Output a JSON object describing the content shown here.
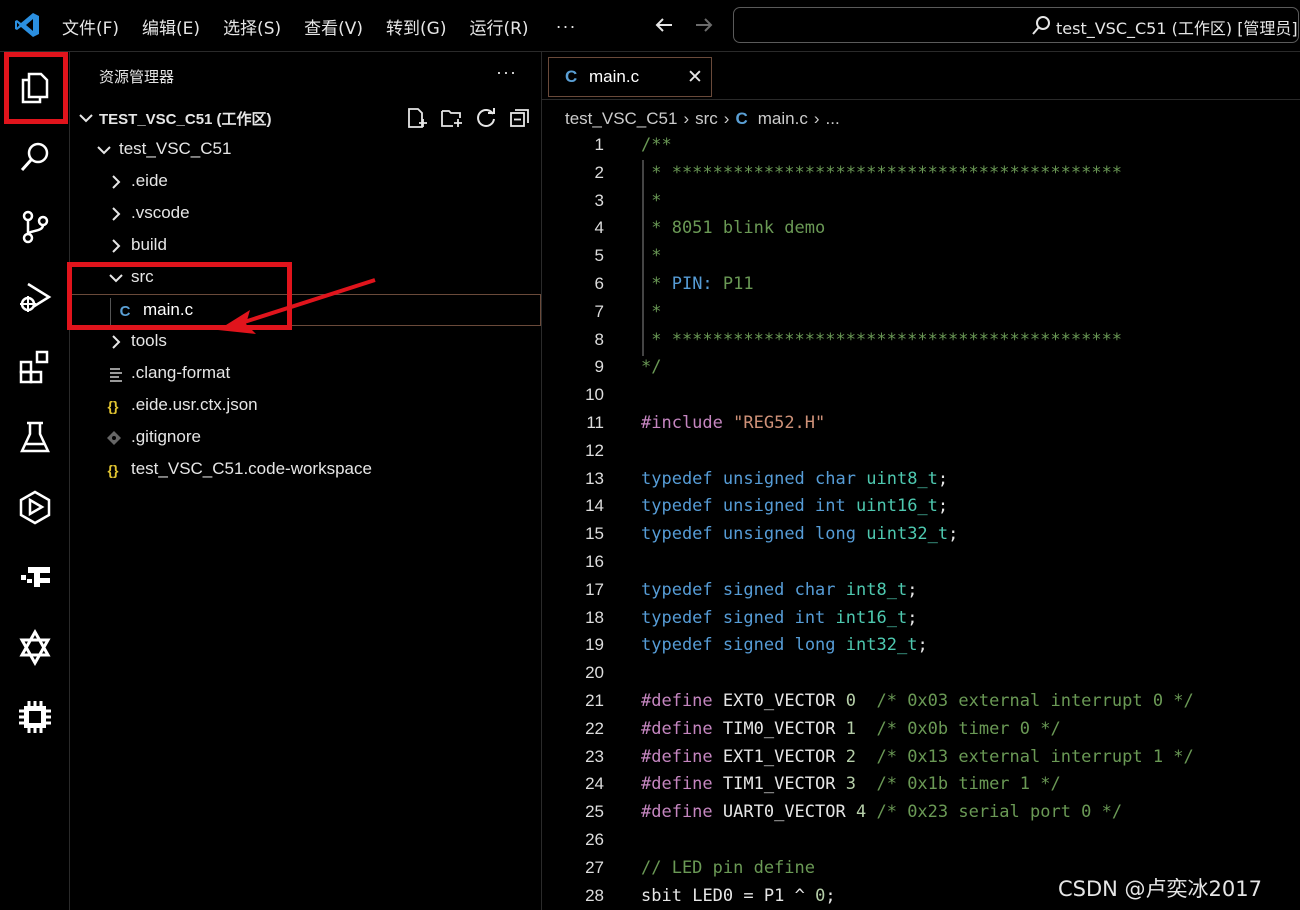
{
  "titlebar": {
    "menu": [
      "文件(F)",
      "编辑(E)",
      "选择(S)",
      "查看(V)",
      "转到(G)",
      "运行(R)"
    ],
    "more": "···",
    "command_center": "test_VSC_C51 (工作区) [管理员]"
  },
  "activity_bar": {
    "items": [
      "explorer-icon",
      "search-icon",
      "source-control-icon",
      "run-debug-icon",
      "extensions-icon",
      "testing-icon",
      "eide-icon",
      "platformio-icon",
      "remote-icon",
      "chip-icon"
    ],
    "highlight_color": "#e0141c"
  },
  "sidebar": {
    "title": "资源管理器",
    "more": "···",
    "workspace": "TEST_VSC_C51 (工作区)",
    "tree": [
      {
        "label": "test_VSC_C51",
        "type": "folder-open"
      },
      {
        "label": ".eide",
        "type": "folder"
      },
      {
        "label": ".vscode",
        "type": "folder"
      },
      {
        "label": "build",
        "type": "folder"
      },
      {
        "label": "src",
        "type": "folder-open"
      },
      {
        "label": "main.c",
        "type": "c-file",
        "icon": "C"
      },
      {
        "label": "tools",
        "type": "folder"
      },
      {
        "label": ".clang-format",
        "type": "text-file"
      },
      {
        "label": ".eide.usr.ctx.json",
        "type": "json-file",
        "icon": "{}"
      },
      {
        "label": ".gitignore",
        "type": "git-file"
      },
      {
        "label": "test_VSC_C51.code-workspace",
        "type": "json-file",
        "icon": "{}"
      }
    ]
  },
  "editor": {
    "tab": {
      "icon": "C",
      "label": "main.c",
      "close": "✕"
    },
    "breadcrumb": [
      "test_VSC_C51",
      "src",
      "main.c",
      "..."
    ],
    "breadcrumb_icon": "C",
    "lines": [
      {
        "n": "1",
        "text": "/**"
      },
      {
        "n": "2",
        "text": " * ********************************************"
      },
      {
        "n": "3",
        "text": " *"
      },
      {
        "n": "4",
        "text": " * 8051 blink demo"
      },
      {
        "n": "5",
        "text": " *"
      },
      {
        "n": "6",
        "text": " * PIN: P11"
      },
      {
        "n": "7",
        "text": " *"
      },
      {
        "n": "8",
        "text": " * ********************************************"
      },
      {
        "n": "9",
        "text": "*/"
      },
      {
        "n": "10",
        "text": ""
      },
      {
        "n": "11",
        "text": "#include \"REG52.H\""
      },
      {
        "n": "12",
        "text": ""
      },
      {
        "n": "13",
        "text": "typedef unsigned char uint8_t;"
      },
      {
        "n": "14",
        "text": "typedef unsigned int uint16_t;"
      },
      {
        "n": "15",
        "text": "typedef unsigned long uint32_t;"
      },
      {
        "n": "16",
        "text": ""
      },
      {
        "n": "17",
        "text": "typedef signed char int8_t;"
      },
      {
        "n": "18",
        "text": "typedef signed int int16_t;"
      },
      {
        "n": "19",
        "text": "typedef signed long int32_t;"
      },
      {
        "n": "20",
        "text": ""
      },
      {
        "n": "21",
        "text": "#define EXT0_VECTOR 0  /* 0x03 external interrupt 0 */"
      },
      {
        "n": "22",
        "text": "#define TIM0_VECTOR 1  /* 0x0b timer 0 */"
      },
      {
        "n": "23",
        "text": "#define EXT1_VECTOR 2  /* 0x13 external interrupt 1 */"
      },
      {
        "n": "24",
        "text": "#define TIM1_VECTOR 3  /* 0x1b timer 1 */"
      },
      {
        "n": "25",
        "text": "#define UART0_VECTOR 4 /* 0x23 serial port 0 */"
      },
      {
        "n": "26",
        "text": ""
      },
      {
        "n": "27",
        "text": "// LED pin define"
      },
      {
        "n": "28",
        "text": "sbit LED0 = P1 ^ 0;"
      }
    ]
  },
  "watermark": "CSDN @卢奕冰2017"
}
